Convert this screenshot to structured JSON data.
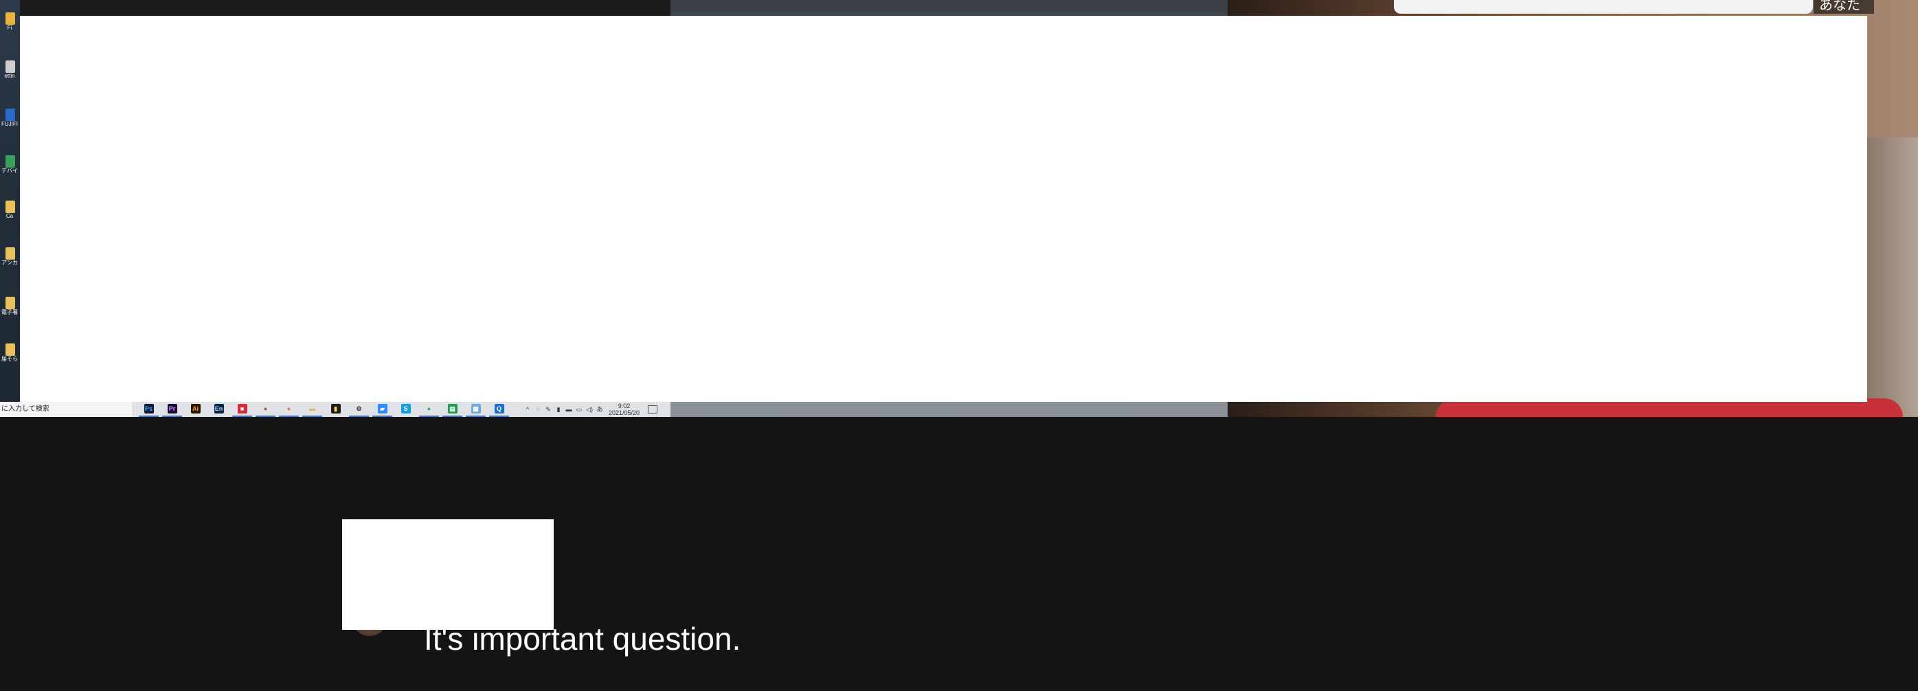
{
  "desktop_icons": [
    {
      "name": "app-icon",
      "label": "Fi",
      "color": "#e8b33a"
    },
    {
      "name": "settings-icon",
      "label": "ettin",
      "color": "#cfcfcf"
    },
    {
      "name": "album-icon",
      "label": "FUJIFI Album",
      "color": "#2a6ad0"
    },
    {
      "name": "device-icon",
      "label": "デバイス",
      "color": "#3aa05a"
    },
    {
      "name": "folder-icon",
      "label": "Ca",
      "color": "#e8c15a"
    },
    {
      "name": "shortcut-icon",
      "label": "アンカ",
      "color": "#e8c15a"
    },
    {
      "name": "folder-icon",
      "label": "電子署名 - ショ",
      "color": "#e8c15a"
    },
    {
      "name": "folder-icon",
      "label": "届そら",
      "color": "#e8c15a"
    }
  ],
  "taskbar": {
    "search_placeholder": "に入力して検索",
    "apps": [
      {
        "name": "photoshop-icon",
        "label": "Ps",
        "bg": "#0b1a3a",
        "fg": "#4cb0ff",
        "active": true
      },
      {
        "name": "premiere-icon",
        "label": "Pr",
        "bg": "#1f0a35",
        "fg": "#c59bff",
        "active": true
      },
      {
        "name": "illustrator-icon",
        "label": "Ai",
        "bg": "#2b1600",
        "fg": "#ff9a00",
        "active": false
      },
      {
        "name": "encoder-icon",
        "label": "En",
        "bg": "#0a2440",
        "fg": "#9ad0ff",
        "active": false
      },
      {
        "name": "media-icon",
        "label": "■",
        "bg": "#d8283a",
        "fg": "#ffffff",
        "active": true
      },
      {
        "name": "chrome-icon",
        "label": "●",
        "bg": "#e0e3e8",
        "fg": "#d6402c",
        "active": true
      },
      {
        "name": "firefox-icon",
        "label": "●",
        "bg": "#e0e3e8",
        "fg": "#ff6a2a",
        "active": true
      },
      {
        "name": "file-explorer-icon",
        "label": "▬",
        "bg": "#e0e3e8",
        "fg": "#e8b634",
        "active": true
      },
      {
        "name": "terminal-icon",
        "label": "▮",
        "bg": "#1c1c1c",
        "fg": "#ffd24a",
        "active": false
      },
      {
        "name": "gear-icon",
        "label": "⚙",
        "bg": "#e0e3e8",
        "fg": "#333333",
        "active": true
      },
      {
        "name": "zoom-icon",
        "label": "▰",
        "bg": "#2d8cff",
        "fg": "#ffffff",
        "active": true
      },
      {
        "name": "skype-icon",
        "label": "S",
        "bg": "#0aa0e8",
        "fg": "#ffffff",
        "active": false
      },
      {
        "name": "chrome-icon-2",
        "label": "●",
        "bg": "#e0e3e8",
        "fg": "#34a853",
        "active": true
      },
      {
        "name": "sheets-icon",
        "label": "▤",
        "bg": "#1f9d55",
        "fg": "#ffffff",
        "active": true
      },
      {
        "name": "docs-icon",
        "label": "▦",
        "bg": "#6fa8dc",
        "fg": "#ffffff",
        "active": true
      },
      {
        "name": "app-q-icon",
        "label": "Q",
        "bg": "#1a6fd0",
        "fg": "#ffffff",
        "active": true
      }
    ],
    "tray": [
      "^",
      "◌",
      "✎",
      "▮",
      "▬",
      "▭",
      "◁)",
      "あ"
    ],
    "time": "9:02",
    "date": "2021/05/20"
  },
  "participant_name": "あなた",
  "caption": {
    "text": "It's important question."
  }
}
